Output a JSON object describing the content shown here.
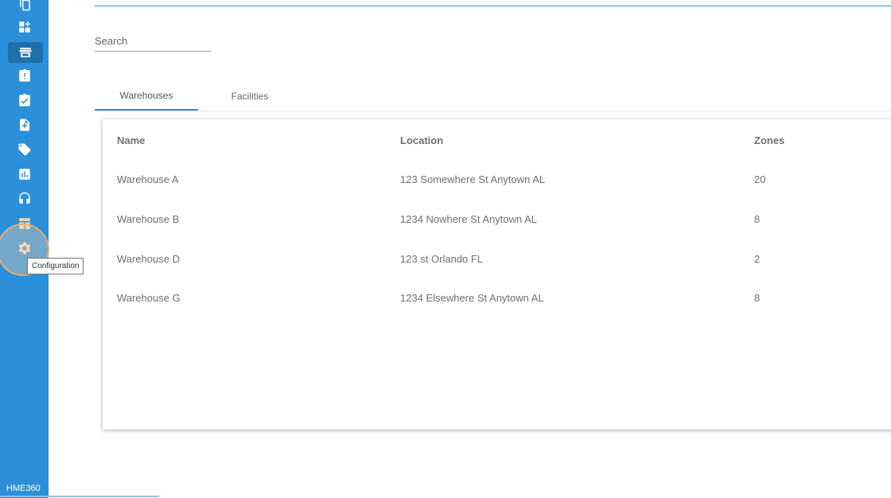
{
  "sidebar": {
    "brand": "HME360",
    "items": [
      {
        "icon": "clipboard-copy-icon"
      },
      {
        "icon": "dashboard-add-icon"
      },
      {
        "icon": "store-icon"
      },
      {
        "icon": "clipboard-alert-icon"
      },
      {
        "icon": "clipboard-check-icon"
      },
      {
        "icon": "document-add-icon"
      },
      {
        "icon": "tag-icon"
      },
      {
        "icon": "chart-icon"
      },
      {
        "icon": "headset-icon"
      },
      {
        "icon": "grid-layout-icon"
      },
      {
        "icon": "gear-icon"
      }
    ],
    "tooltip": "Configuration"
  },
  "search": {
    "placeholder": "Search",
    "value": ""
  },
  "tabs": [
    {
      "label": "Warehouses",
      "active": true
    },
    {
      "label": "Facilities",
      "active": false
    }
  ],
  "table": {
    "headers": [
      "Name",
      "Location",
      "Zones"
    ],
    "rows": [
      [
        "Warehouse A",
        "123 Somewhere St Anytown AL",
        "20"
      ],
      [
        "Warehouse B",
        "1234 Nowhere St Anytown AL",
        "8"
      ],
      [
        "Warehouse D",
        "123 st Orlando FL",
        "2"
      ],
      [
        "Warehouse G",
        "1234 Elsewhere St Anytown AL",
        "8"
      ]
    ]
  },
  "colors": {
    "accent": "#2b90d9",
    "sidebar": "#2b90d9",
    "highlight": "#1f6fab"
  }
}
